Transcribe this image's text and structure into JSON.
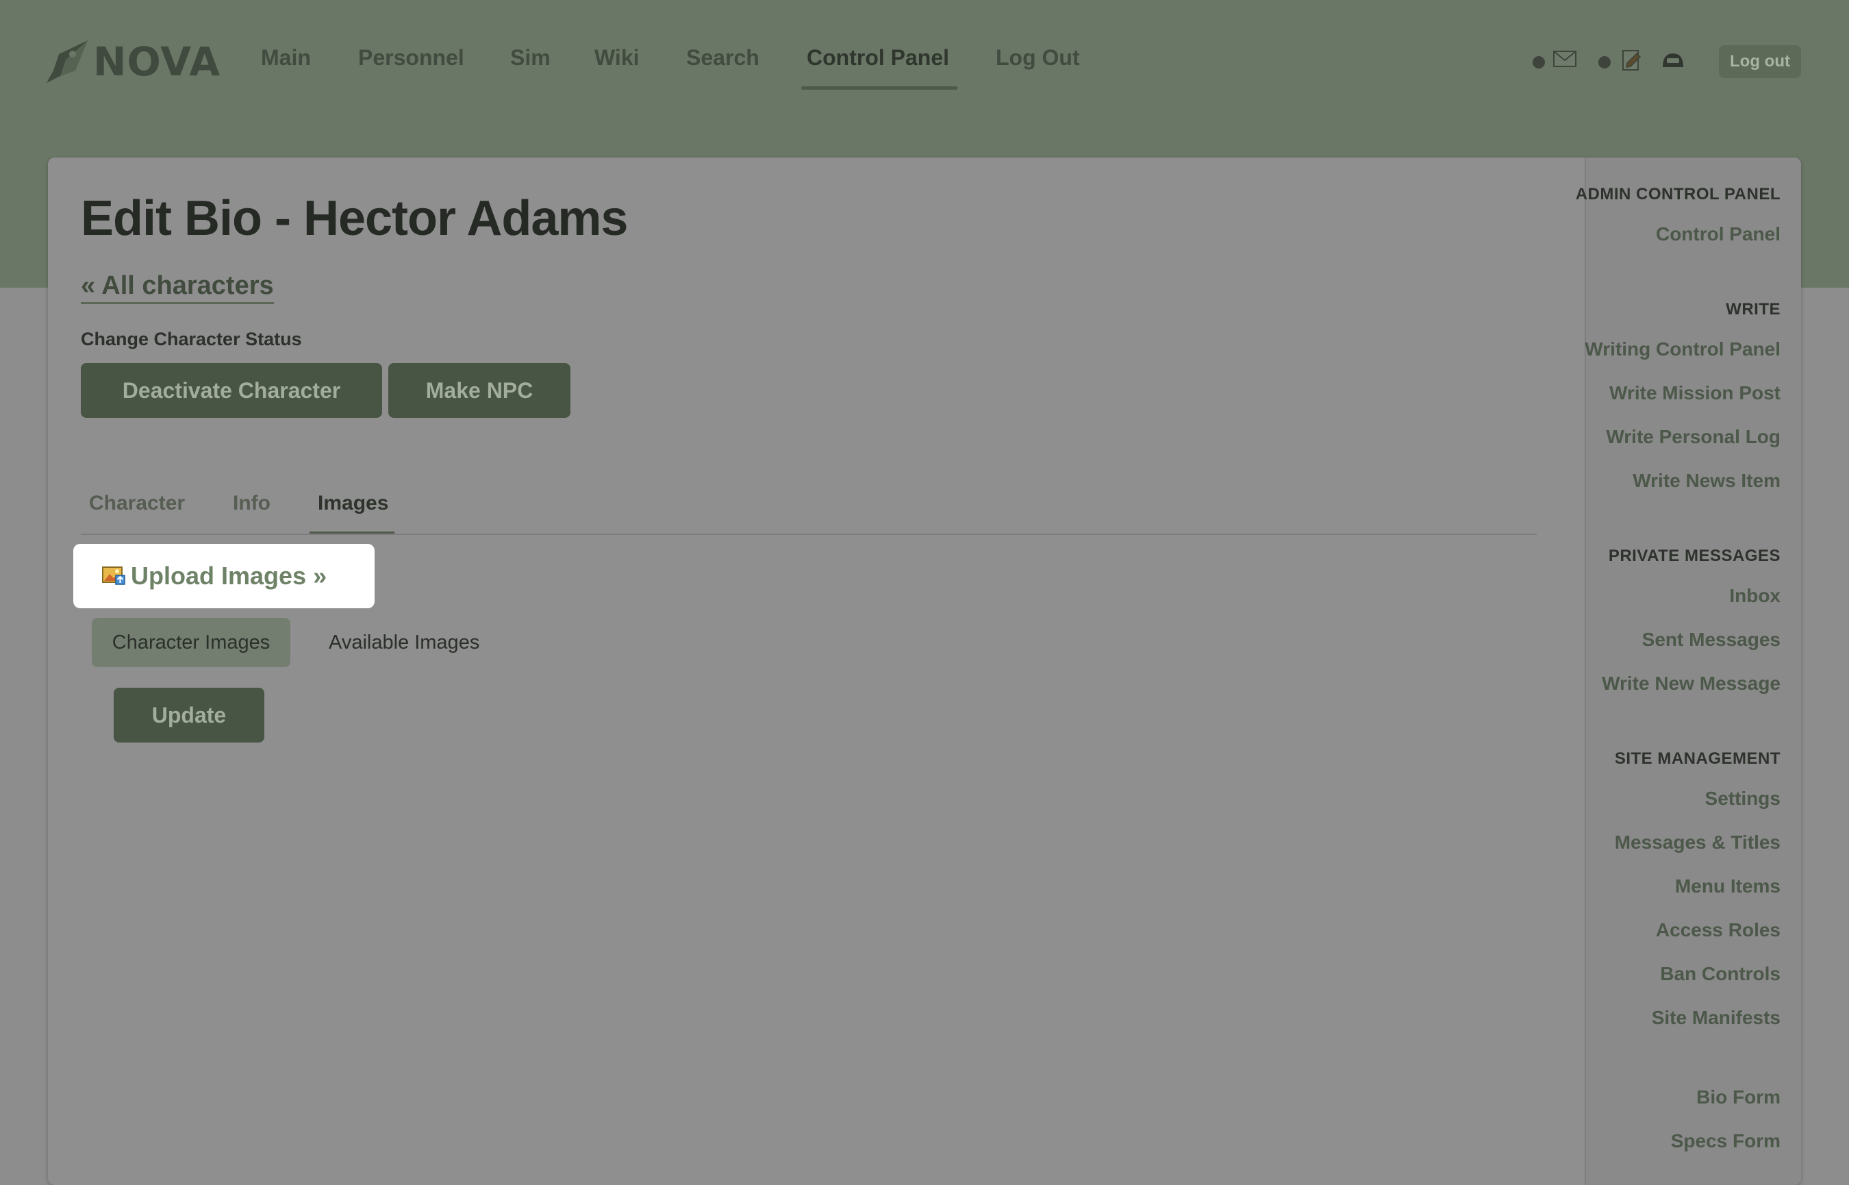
{
  "brand": {
    "logo_text": "NOVA"
  },
  "nav": {
    "items": [
      {
        "label": "Main"
      },
      {
        "label": "Personnel"
      },
      {
        "label": "Sim"
      },
      {
        "label": "Wiki"
      },
      {
        "label": "Search"
      },
      {
        "label": "Control Panel",
        "active": true
      },
      {
        "label": "Log Out"
      }
    ],
    "logout_button": "Log out",
    "icons": [
      "mail-icon",
      "document-edit-icon",
      "helmet-icon"
    ]
  },
  "page": {
    "title": "Edit Bio - Hector Adams",
    "back_link": "« All characters",
    "status_label": "Change Character Status",
    "buttons": {
      "deactivate": "Deactivate Character",
      "make_npc": "Make NPC"
    },
    "tabs": [
      {
        "label": "Character"
      },
      {
        "label": "Info"
      },
      {
        "label": "Images",
        "active": true
      }
    ],
    "upload_link": "Upload Images »",
    "subtabs": {
      "character_images": "Character Images",
      "available_images": "Available Images"
    },
    "update_button": "Update"
  },
  "sidebar": {
    "sections": [
      {
        "heading": "ADMIN CONTROL PANEL",
        "links": [
          "Control Panel"
        ]
      },
      {
        "heading": "WRITE",
        "links": [
          "Writing Control Panel",
          "Write Mission Post",
          "Write Personal Log",
          "Write News Item"
        ]
      },
      {
        "heading": "PRIVATE MESSAGES",
        "links": [
          "Inbox",
          "Sent Messages",
          "Write New Message"
        ]
      },
      {
        "heading": "SITE MANAGEMENT",
        "links": [
          "Settings",
          "Messages & Titles",
          "Menu Items",
          "Access Roles",
          "Ban Controls",
          "Site Manifests"
        ]
      },
      {
        "heading": "",
        "links": [
          "Bio Form",
          "Specs Form"
        ]
      }
    ]
  },
  "colors": {
    "header_bg": "#6b7766",
    "page_bg": "#8d8d8d",
    "button_bg": "#485444",
    "link_green": "#6e8267"
  }
}
